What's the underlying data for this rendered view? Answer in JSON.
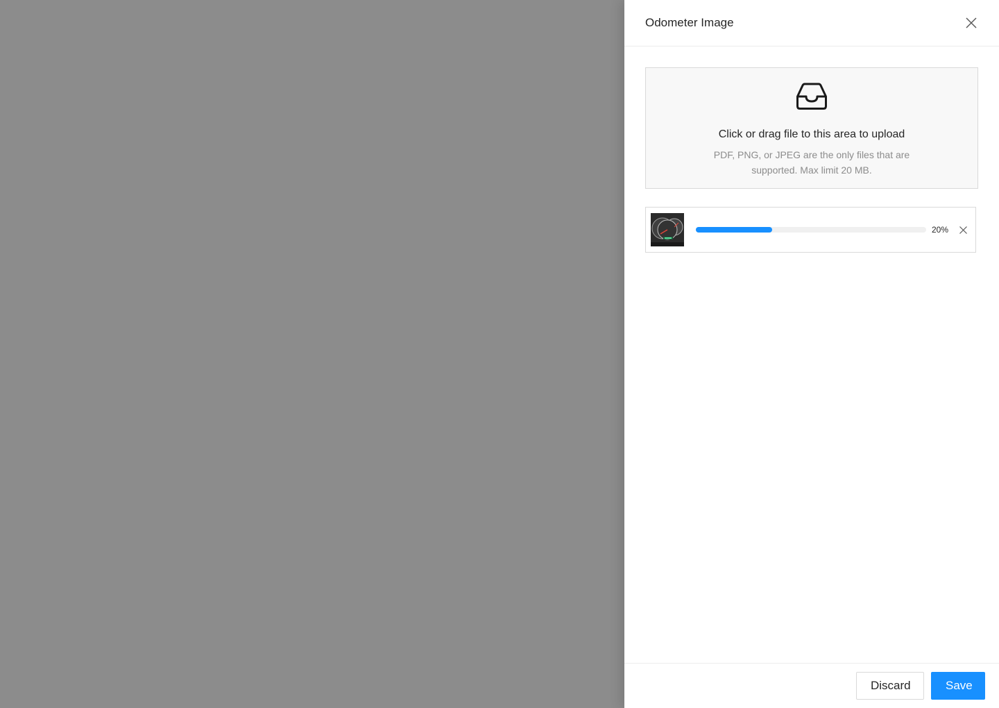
{
  "drawer": {
    "title": "Odometer Image",
    "close_icon": "close-icon"
  },
  "upload": {
    "icon": "inbox-icon",
    "title": "Click or drag file to this area to upload",
    "hint": "PDF, PNG, or JPEG are the only files that are supported. Max limit 20 MB."
  },
  "file_item": {
    "thumbnail_icon": "odometer-thumbnail",
    "progress_percent": 33,
    "progress_label": "20%",
    "remove_icon": "close-icon"
  },
  "footer": {
    "discard_label": "Discard",
    "save_label": "Save"
  },
  "colors": {
    "primary": "#1890ff",
    "overlay": "#8c8c8c",
    "border": "#d9d9d9"
  }
}
